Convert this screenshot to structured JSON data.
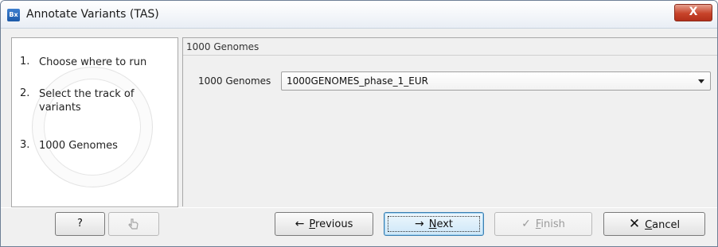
{
  "window": {
    "title": "Annotate Variants (TAS)",
    "app_icon": "Bx",
    "close_glyph": "X"
  },
  "steps": [
    {
      "num": "1.",
      "label": "Choose where to run"
    },
    {
      "num": "2.",
      "label": "Select the track of variants"
    },
    {
      "num": "3.",
      "label": "1000 Genomes"
    }
  ],
  "content": {
    "section_title": "1000 Genomes",
    "field_label": "1000 Genomes",
    "selected_value": "1000GENOMES_phase_1_EUR"
  },
  "buttons": {
    "help": "?",
    "previous": {
      "icon": "arrow-left",
      "mnemonic": "P",
      "rest": "revious"
    },
    "next": {
      "icon": "arrow-right",
      "mnemonic": "N",
      "rest": "ext"
    },
    "finish": {
      "icon": "checkmark",
      "mnemonic": "F",
      "rest": "inish"
    },
    "cancel": {
      "icon": "x-mark",
      "mnemonic": "C",
      "rest": "ancel"
    }
  },
  "icons": {
    "arrow_left": "←",
    "arrow_right": "→",
    "check": "✓",
    "x": "✕"
  }
}
